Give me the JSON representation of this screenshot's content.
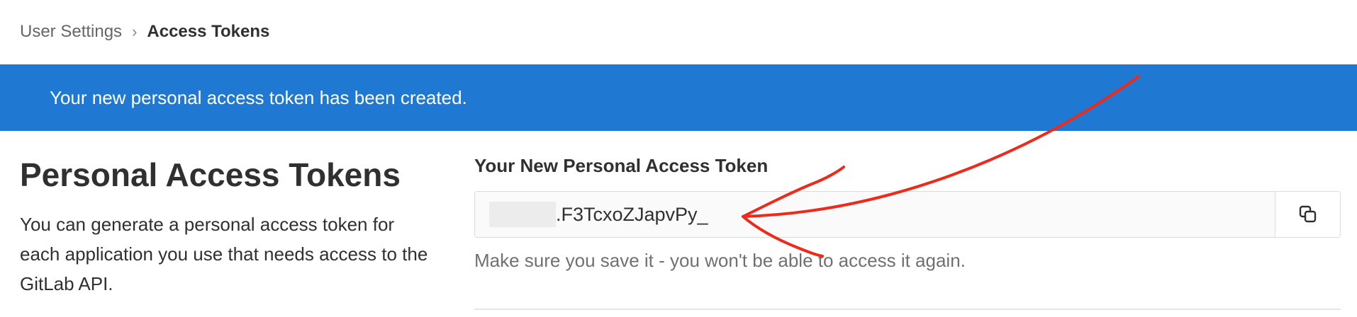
{
  "breadcrumb": {
    "parent": "User Settings",
    "separator": "›",
    "current": "Access Tokens"
  },
  "banner": {
    "message": "Your new personal access token has been created."
  },
  "left": {
    "title": "Personal Access Tokens",
    "description": "You can generate a personal access token for each application you use that needs access to the GitLab API."
  },
  "token": {
    "label": "Your New Personal Access Token",
    "value_visible": ".F3TcxoZJapvPy_",
    "help": "Make sure you save it - you won't be able to access it again.",
    "copy_icon": "copy-icon"
  },
  "colors": {
    "banner": "#1f78d1",
    "annotation": "#f02a1a"
  }
}
